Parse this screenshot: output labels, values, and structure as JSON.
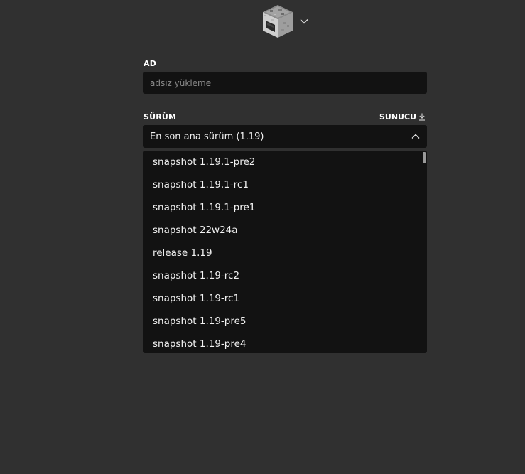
{
  "header": {
    "icon": "furnace-block-icon",
    "dropdown_icon": "chevron-down-icon"
  },
  "name_field": {
    "label": "AD",
    "placeholder": "adsız yükleme",
    "value": ""
  },
  "version_field": {
    "label": "SÜRÜM",
    "server_link_label": "SUNUCU",
    "server_icon": "download-icon",
    "selected": "En son ana sürüm (1.19)",
    "toggle_icon": "chevron-up-icon",
    "options": [
      "snapshot 1.19.1-pre2",
      "snapshot 1.19.1-rc1",
      "snapshot 1.19.1-pre1",
      "snapshot 22w24a",
      "release 1.19",
      "snapshot 1.19-rc2",
      "snapshot 1.19-rc1",
      "snapshot 1.19-pre5",
      "snapshot 1.19-pre4"
    ]
  },
  "colors": {
    "background": "#303030",
    "field": "#121212",
    "text": "#ffffff",
    "placeholder": "#8a8a8a"
  }
}
